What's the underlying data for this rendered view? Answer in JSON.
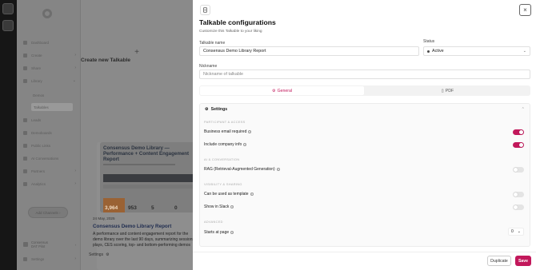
{
  "sidebar": {
    "items": [
      {
        "label": "Dashboard",
        "has_children": false
      },
      {
        "label": "Create",
        "has_children": true
      },
      {
        "label": "Share",
        "has_children": true
      },
      {
        "label": "Library",
        "has_children": true
      },
      {
        "label": "Demos",
        "has_children": false
      },
      {
        "label": "Talkables",
        "has_children": false
      },
      {
        "label": "Leads",
        "has_children": false
      },
      {
        "label": "Demoboards",
        "has_children": false
      },
      {
        "label": "Public Links",
        "has_children": false
      },
      {
        "label": "AI Conversations",
        "has_children": false
      },
      {
        "label": "Partners",
        "has_children": true
      },
      {
        "label": "Analytics",
        "has_children": true
      }
    ],
    "upgrade_label": "Add Channels",
    "workspace": {
      "name": "Consensus",
      "sub": "DAT Pilot"
    },
    "settings_label": "Settings"
  },
  "background": {
    "create_label": "Create new Talkable",
    "card": {
      "thumb_title": "Consensus Demo Library — Performance + Content Engagement Report",
      "stat_1": "3,964",
      "stat_2": "953",
      "stat_3": "5",
      "stat_4": "0",
      "date": "24 May, 2025",
      "title": "Consensus Demo Library Report",
      "desc": "A performance and content engagement report for the demo library over the last 90 days, summarizing sessions, plays, CES scoring, top- and bottom-performing demos",
      "settings_label": "Settings"
    }
  },
  "modal": {
    "title": "Talkable configurations",
    "subtitle": "Customize this Talkable to your liking",
    "name_label": "Talkable name",
    "name_value": "Consensus Demo Library Report",
    "status_label": "Status",
    "status_value": "Active",
    "nickname_label": "Nickname",
    "nickname_placeholder": "Nickname of talkable",
    "tabs": [
      {
        "label": "General",
        "icon": "gear-icon",
        "active": true
      },
      {
        "label": "PDF",
        "icon": "document-icon",
        "active": false
      }
    ],
    "settings_title": "Settings",
    "sections": {
      "participant": "PARTICIPANT & ACCESS",
      "ai": "AI & CONVERSATION",
      "visibility": "VISIBILITY & SHARING",
      "advanced": "ADVANCED"
    },
    "options": {
      "business_email": {
        "label": "Business email required",
        "on": true
      },
      "company_info": {
        "label": "Include company info",
        "on": true
      },
      "rag": {
        "label": "RAG (Retrieval-Augmented Generation)",
        "on": false
      },
      "template": {
        "label": "Can be used as template",
        "on": false
      },
      "slack": {
        "label": "Show in Slack",
        "on": false
      },
      "starts_at_page": {
        "label": "Starts at page",
        "value": "0"
      }
    },
    "duplicate_label": "Duplicate",
    "save_label": "Save"
  },
  "colors": {
    "accent": "#c2185b",
    "overlay": "#8a8a8a"
  }
}
